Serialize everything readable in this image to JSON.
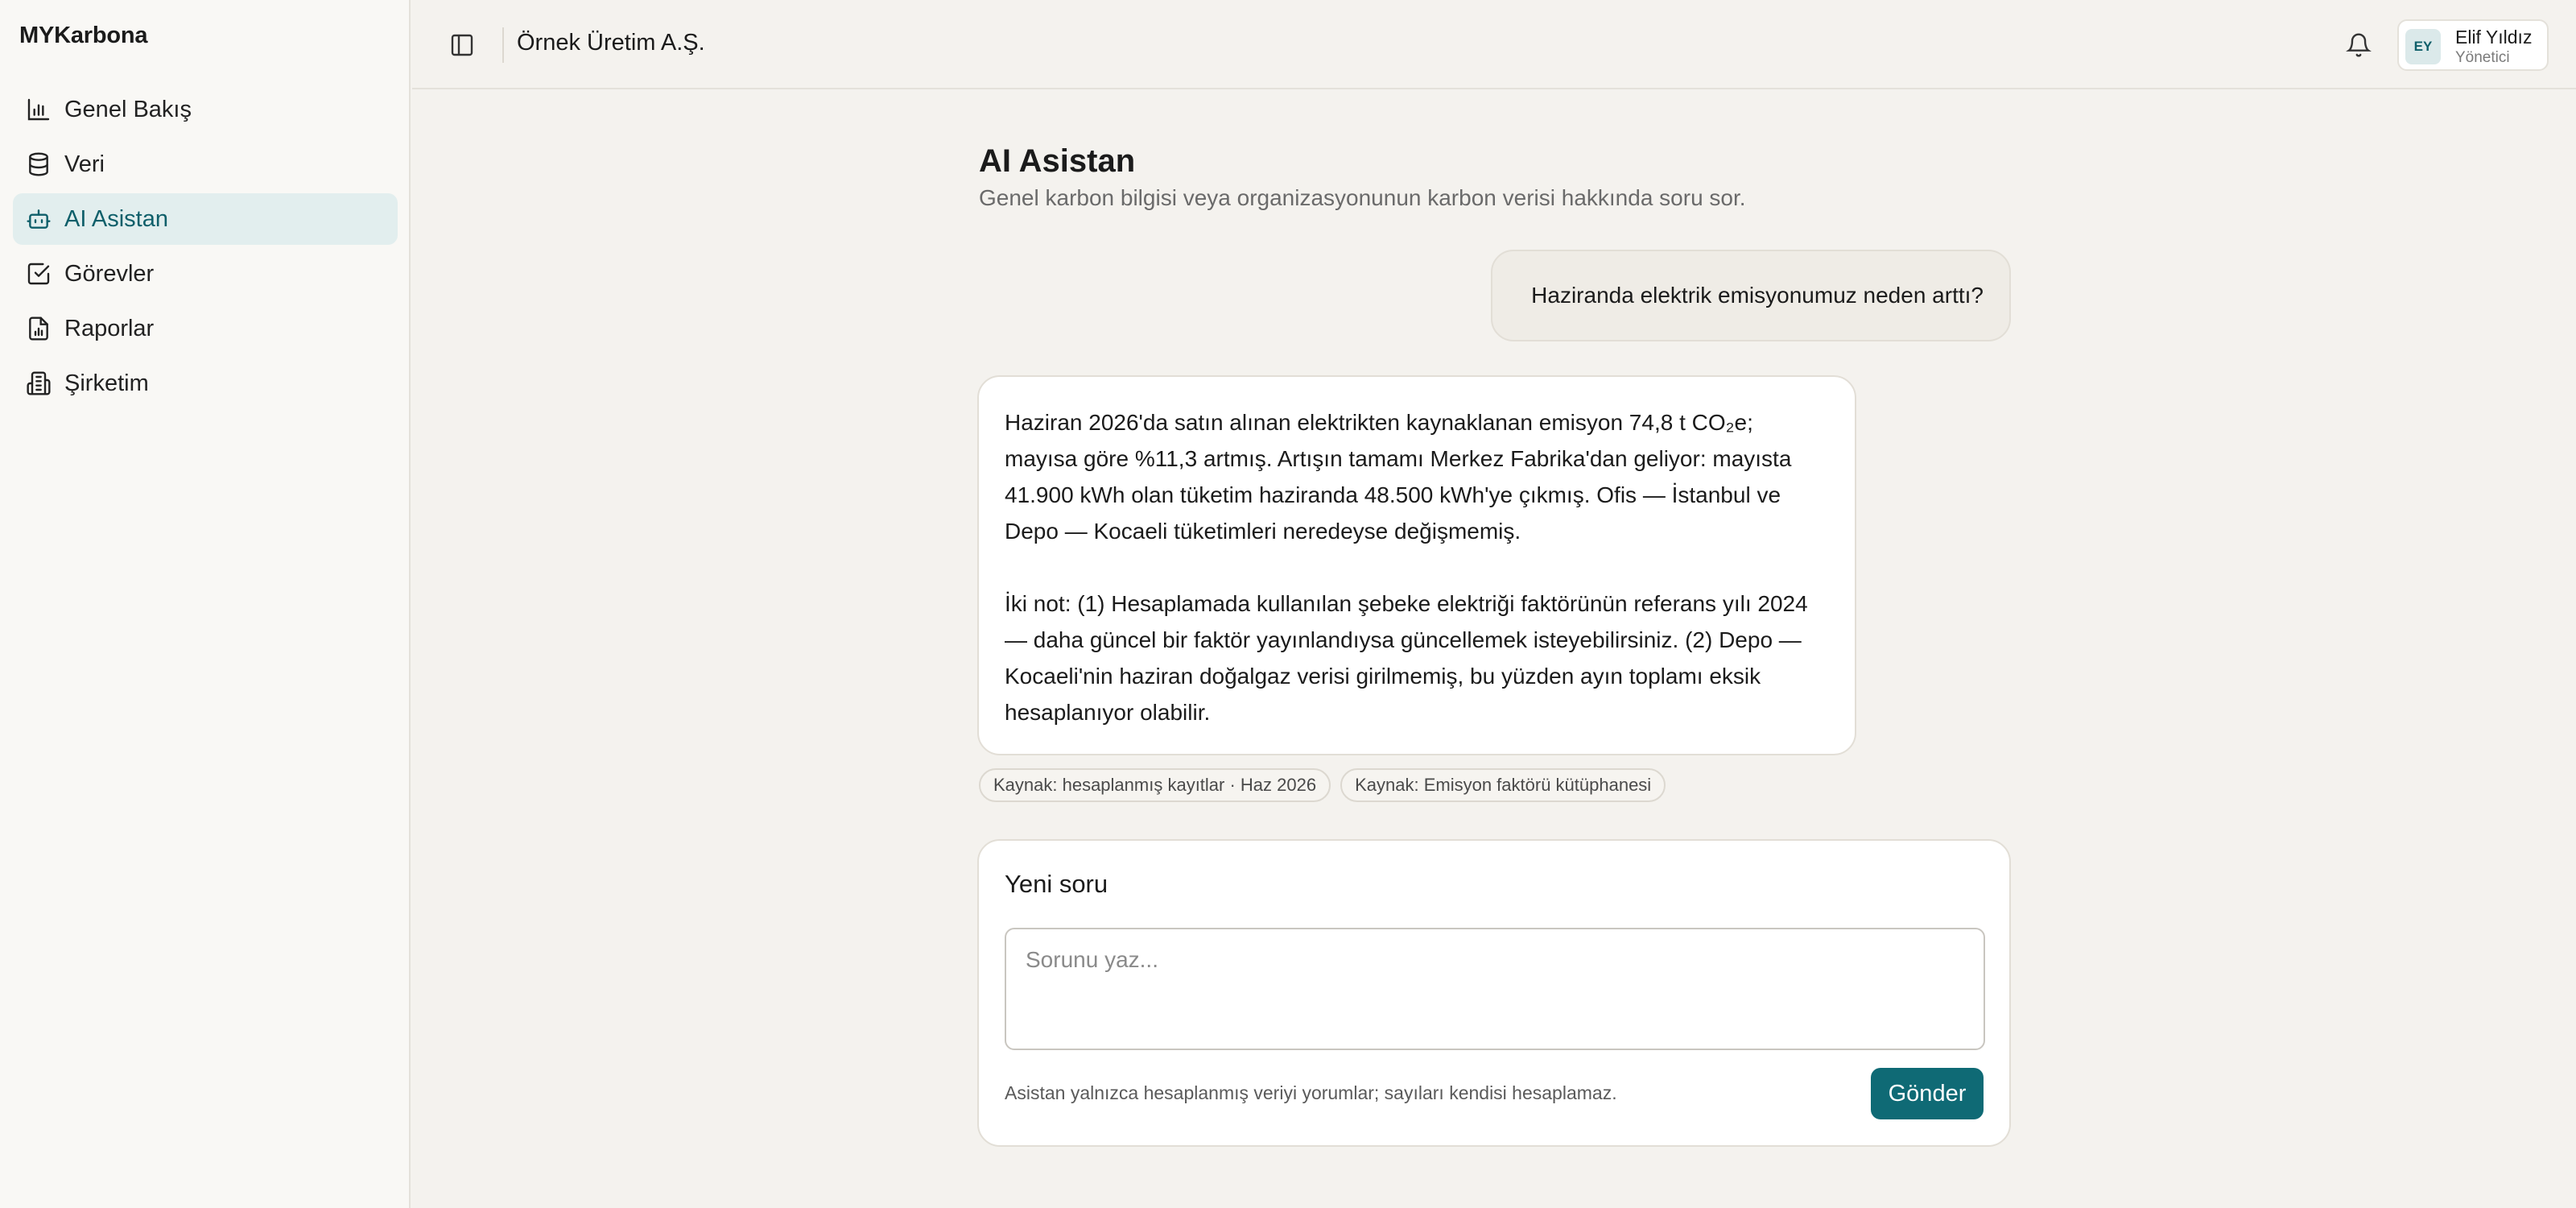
{
  "app": {
    "brand": "MYKarbona"
  },
  "sidebar": {
    "items": [
      {
        "label": "Genel Bakış",
        "icon": "bar-chart-icon"
      },
      {
        "label": "Veri",
        "icon": "database-icon"
      },
      {
        "label": "AI Asistan",
        "icon": "bot-icon",
        "active": true
      },
      {
        "label": "Görevler",
        "icon": "checkbox-icon"
      },
      {
        "label": "Raporlar",
        "icon": "report-icon"
      },
      {
        "label": "Şirketim",
        "icon": "building-icon"
      }
    ]
  },
  "header": {
    "org_name": "Örnek Üretim A.Ş.",
    "user": {
      "initials": "EY",
      "name": "Elif Yıldız",
      "role": "Yönetici"
    }
  },
  "main": {
    "title": "AI Asistan",
    "subtitle": "Genel karbon bilgisi veya organizasyonunun karbon verisi hakkında soru sor.",
    "user_message": "Haziranda elektrik emisyonumuz neden arttı?",
    "assistant_message": {
      "paragraph_1": "Haziran 2026'da satın alınan elektrikten kaynaklanan emisyon 74,8 t CO₂e; mayısa göre %11,3 artmış. Artışın tamamı Merkez Fabrika'dan geliyor: mayısta 41.900 kWh olan tüketim haziranda 48.500 kWh'ye çıkmış. Ofis — İstanbul ve Depo — Kocaeli tüketimleri neredeyse değişmemiş.",
      "paragraph_2": "İki not: (1) Hesaplamada kullanılan şebeke elektriği faktörünün referans yılı 2024 — daha güncel bir faktör yayınlandıysa güncellemek isteyebilirsiniz. (2) Depo — Kocaeli'nin haziran doğalgaz verisi girilmemiş, bu yüzden ayın toplamı eksik hesaplanıyor olabilir."
    },
    "sources": [
      "Kaynak: hesaplanmış kayıtlar · Haz 2026",
      "Kaynak: Emisyon faktörü kütüphanesi"
    ],
    "new_question": {
      "title": "Yeni soru",
      "placeholder": "Sorunu yaz...",
      "value": "",
      "note": "Asistan yalnızca hesaplanmış veriyi yorumlar; sayıları kendisi hesaplamaz.",
      "send_label": "Gönder"
    }
  },
  "colors": {
    "accent": "#0f6a75",
    "active_nav_bg": "#e2eeee",
    "background": "#f4f2ee"
  }
}
